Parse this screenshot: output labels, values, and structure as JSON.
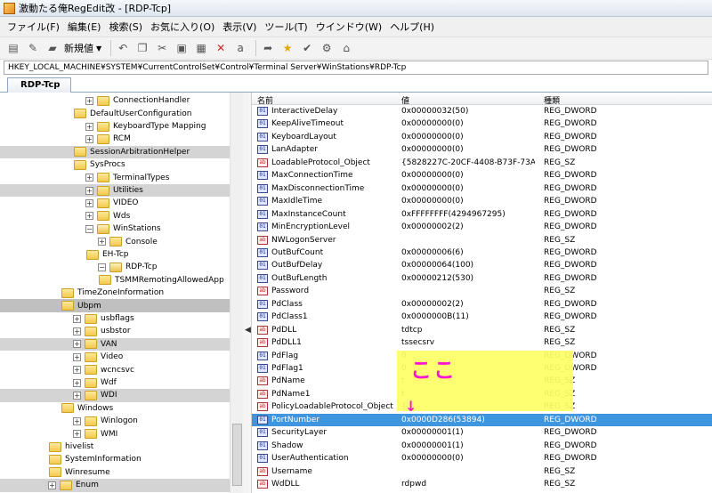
{
  "window": {
    "title": "激動たる俺RegEdit改 - [RDP-Tcp]"
  },
  "menu": [
    "ファイル(F)",
    "編集(E)",
    "検索(S)",
    "お気に入り(O)",
    "表示(V)",
    "ツール(T)",
    "ウインドウ(W)",
    "ヘルプ(H)"
  ],
  "toolbar": {
    "new_label": "新規値"
  },
  "address": {
    "path": "HKEY_LOCAL_MACHINE¥SYSTEM¥CurrentControlSet¥Control¥Terminal Server¥WinStations¥RDP-Tcp"
  },
  "tab": {
    "label": "RDP-Tcp"
  },
  "tree": {
    "items": [
      {
        "label": "ConnectionHandler",
        "expander": "+",
        "state": ""
      },
      {
        "label": "DefaultUserConfiguration",
        "expander": "",
        "state": ""
      },
      {
        "label": "KeyboardType Mapping",
        "expander": "+",
        "state": ""
      },
      {
        "label": "RCM",
        "expander": "+",
        "state": ""
      },
      {
        "label": "SessionArbitrationHelper",
        "expander": "",
        "state": "sel"
      },
      {
        "label": "SysProcs",
        "expander": "",
        "state": ""
      },
      {
        "label": "TerminalTypes",
        "expander": "+",
        "state": ""
      },
      {
        "label": "Utilities",
        "expander": "+",
        "state": "sel"
      },
      {
        "label": "VIDEO",
        "expander": "+",
        "state": ""
      },
      {
        "label": "Wds",
        "expander": "+",
        "state": ""
      },
      {
        "label": "WinStations",
        "expander": "−",
        "state": ""
      },
      {
        "label": "Console",
        "expander": "+",
        "state": ""
      },
      {
        "label": "EH-Tcp",
        "expander": "",
        "state": ""
      },
      {
        "label": "RDP-Tcp",
        "expander": "−",
        "state": ""
      },
      {
        "label": "TSMMRemotingAllowedApp",
        "expander": "",
        "state": ""
      },
      {
        "label": "TimeZoneInformation",
        "expander": "",
        "state": ""
      },
      {
        "label": "Ubpm",
        "expander": "",
        "state": "sel-strong"
      },
      {
        "label": "usbflags",
        "expander": "+",
        "state": ""
      },
      {
        "label": "usbstor",
        "expander": "+",
        "state": ""
      },
      {
        "label": "VAN",
        "expander": "+",
        "state": "sel"
      },
      {
        "label": "Video",
        "expander": "+",
        "state": ""
      },
      {
        "label": "wcncsvc",
        "expander": "+",
        "state": ""
      },
      {
        "label": "Wdf",
        "expander": "+",
        "state": ""
      },
      {
        "label": "WDI",
        "expander": "+",
        "state": "sel"
      },
      {
        "label": "Windows",
        "expander": "",
        "state": ""
      },
      {
        "label": "Winlogon",
        "expander": "+",
        "state": ""
      },
      {
        "label": "WMI",
        "expander": "+",
        "state": ""
      },
      {
        "label": "hivelist",
        "expander": "",
        "state": ""
      },
      {
        "label": "SystemInformation",
        "expander": "",
        "state": ""
      },
      {
        "label": "Winresume",
        "expander": "",
        "state": ""
      },
      {
        "label": "Enum",
        "expander": "+",
        "state": "sel"
      }
    ]
  },
  "values": {
    "columns": {
      "name": "名前",
      "data": "値",
      "type": "種類"
    },
    "rows": [
      {
        "name": "InteractiveDelay",
        "data": "0x00000032(50)",
        "type": "REG_DWORD",
        "icon": "dword"
      },
      {
        "name": "KeepAliveTimeout",
        "data": "0x00000000(0)",
        "type": "REG_DWORD",
        "icon": "dword"
      },
      {
        "name": "KeyboardLayout",
        "data": "0x00000000(0)",
        "type": "REG_DWORD",
        "icon": "dword"
      },
      {
        "name": "LanAdapter",
        "data": "0x00000000(0)",
        "type": "REG_DWORD",
        "icon": "dword"
      },
      {
        "name": "LoadableProtocol_Object",
        "data": "{5828227C-20CF-4408-B73F-73AB7...",
        "type": "REG_SZ",
        "icon": "sz"
      },
      {
        "name": "MaxConnectionTime",
        "data": "0x00000000(0)",
        "type": "REG_DWORD",
        "icon": "dword"
      },
      {
        "name": "MaxDisconnectionTime",
        "data": "0x00000000(0)",
        "type": "REG_DWORD",
        "icon": "dword"
      },
      {
        "name": "MaxIdleTime",
        "data": "0x00000000(0)",
        "type": "REG_DWORD",
        "icon": "dword"
      },
      {
        "name": "MaxInstanceCount",
        "data": "0xFFFFFFFF(4294967295)",
        "type": "REG_DWORD",
        "icon": "dword"
      },
      {
        "name": "MinEncryptionLevel",
        "data": "0x00000002(2)",
        "type": "REG_DWORD",
        "icon": "dword"
      },
      {
        "name": "NWLogonServer",
        "data": "",
        "type": "REG_SZ",
        "icon": "sz"
      },
      {
        "name": "OutBufCount",
        "data": "0x00000006(6)",
        "type": "REG_DWORD",
        "icon": "dword"
      },
      {
        "name": "OutBufDelay",
        "data": "0x00000064(100)",
        "type": "REG_DWORD",
        "icon": "dword"
      },
      {
        "name": "OutBufLength",
        "data": "0x00000212(530)",
        "type": "REG_DWORD",
        "icon": "dword"
      },
      {
        "name": "Password",
        "data": "",
        "type": "REG_SZ",
        "icon": "sz"
      },
      {
        "name": "PdClass",
        "data": "0x00000002(2)",
        "type": "REG_DWORD",
        "icon": "dword"
      },
      {
        "name": "PdClass1",
        "data": "0x0000000B(11)",
        "type": "REG_DWORD",
        "icon": "dword"
      },
      {
        "name": "PdDLL",
        "data": "tdtcp",
        "type": "REG_SZ",
        "icon": "sz"
      },
      {
        "name": "PdDLL1",
        "data": "tssecsrv",
        "type": "REG_SZ",
        "icon": "sz"
      },
      {
        "name": "PdFlag",
        "data": "0",
        "type": "REG_DWORD",
        "icon": "dword"
      },
      {
        "name": "PdFlag1",
        "data": "0",
        "type": "REG_DWORD",
        "icon": "dword"
      },
      {
        "name": "PdName",
        "data": "t",
        "type": "REG_SZ",
        "icon": "sz"
      },
      {
        "name": "PdName1",
        "data": "t",
        "type": "REG_SZ",
        "icon": "sz"
      },
      {
        "name": "PolicyLoadableProtocol_Object",
        "data": "{",
        "type": "REG_SZ",
        "icon": "sz"
      },
      {
        "name": "PortNumber",
        "data": "0x0000D286(53894)",
        "type": "REG_DWORD",
        "icon": "dword",
        "selected": true
      },
      {
        "name": "SecurityLayer",
        "data": "0x00000001(1)",
        "type": "REG_DWORD",
        "icon": "dword"
      },
      {
        "name": "Shadow",
        "data": "0x00000001(1)",
        "type": "REG_DWORD",
        "icon": "dword"
      },
      {
        "name": "UserAuthentication",
        "data": "0x00000000(0)",
        "type": "REG_DWORD",
        "icon": "dword"
      },
      {
        "name": "Username",
        "data": "",
        "type": "REG_SZ",
        "icon": "sz"
      },
      {
        "name": "WdDLL",
        "data": "rdpwd",
        "type": "REG_SZ",
        "icon": "sz"
      }
    ]
  },
  "annotation": {
    "text": "ここ",
    "arrow": "↓",
    "color": "#ff14d2",
    "bg": "#ffff66"
  }
}
